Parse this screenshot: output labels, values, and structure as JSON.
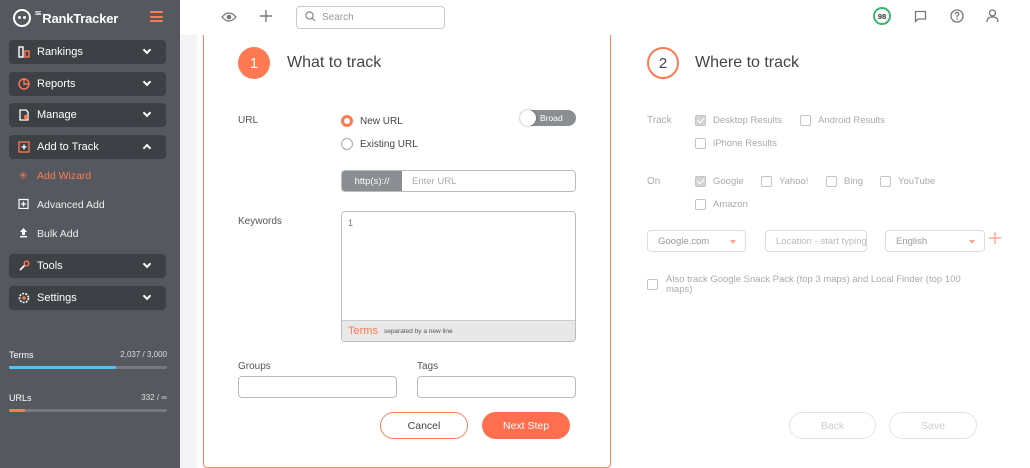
{
  "app": {
    "logo_prefix": "SE",
    "logo_text": "RankTracker"
  },
  "sidebar": {
    "items": [
      {
        "label": "Rankings",
        "icon": "rankings-icon"
      },
      {
        "label": "Reports",
        "icon": "reports-icon"
      },
      {
        "label": "Manage",
        "icon": "manage-icon"
      },
      {
        "label": "Add to Track",
        "icon": "add-to-track-icon"
      },
      {
        "label": "Tools",
        "icon": "tools-icon"
      },
      {
        "label": "Settings",
        "icon": "settings-icon"
      }
    ],
    "subitems": [
      {
        "label": "Add Wizard",
        "active": true
      },
      {
        "label": "Advanced Add",
        "active": false
      },
      {
        "label": "Bulk Add",
        "active": false
      }
    ],
    "usage": {
      "terms": {
        "label": "Terms",
        "value": "2,037 / 3,000",
        "fraction": 0.679,
        "color": "#4fc3f7"
      },
      "urls": {
        "label": "URLs",
        "value": "332 / ∞",
        "fraction": 0.1,
        "color": "#ff7a52"
      }
    }
  },
  "topbar": {
    "search_placeholder": "Search",
    "score": "98",
    "icons": [
      "eye-icon",
      "plus-icon",
      "message-icon",
      "help-icon",
      "user-icon"
    ]
  },
  "step1": {
    "number": "1",
    "title": "What to track",
    "url_label": "URL",
    "radio_new": "New URL",
    "radio_existing": "Existing URL",
    "toggle_label": "Broad",
    "url_prefix": "http(s)://",
    "url_placeholder": "Enter URL",
    "keywords_label": "Keywords",
    "keywords_line_number": "1",
    "terms_label": "Terms",
    "terms_hint": "separated by a new line",
    "groups_label": "Groups",
    "tags_label": "Tags",
    "cancel": "Cancel",
    "next": "Next Step"
  },
  "step2": {
    "number": "2",
    "title": "Where to track",
    "track_label": "Track",
    "track_options": [
      {
        "label": "Desktop Results",
        "checked": true
      },
      {
        "label": "Android Results",
        "checked": false
      },
      {
        "label": "iPhone Results",
        "checked": false
      }
    ],
    "on_label": "On",
    "on_options": [
      {
        "label": "Google",
        "checked": true
      },
      {
        "label": "Yahoo!",
        "checked": false
      },
      {
        "label": "Bing",
        "checked": false
      },
      {
        "label": "YouTube",
        "checked": false
      },
      {
        "label": "Amazon",
        "checked": false
      }
    ],
    "engine_select": "Google.com",
    "location_placeholder": "Location - start typing",
    "language_select": "English",
    "snack_pack_label": "Also track Google Snack Pack (top 3 maps) and Local Finder (top 100 maps)",
    "back": "Back",
    "save": "Save"
  },
  "colors": {
    "accent": "#ff7a52",
    "sidebar_bg": "#55595f",
    "score_ring": "#3cb371"
  }
}
